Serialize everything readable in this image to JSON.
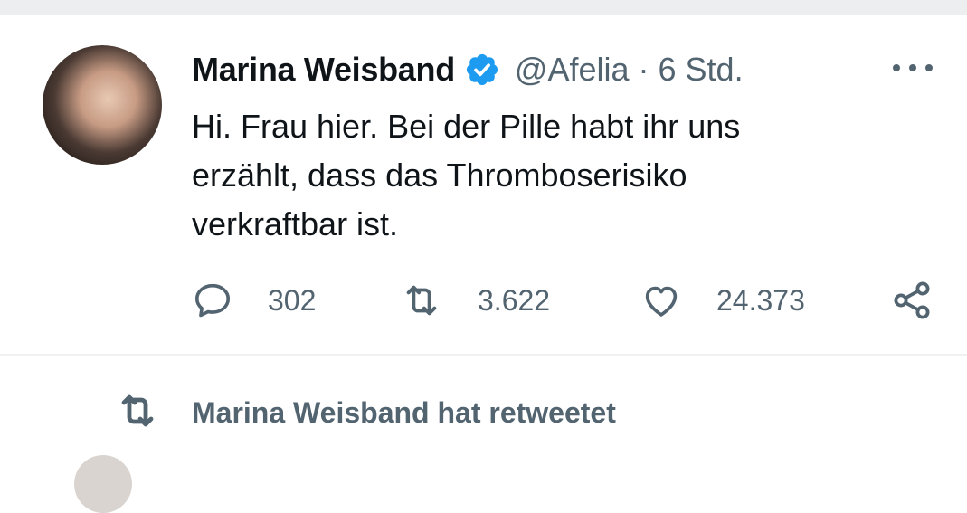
{
  "tweet": {
    "author_name": "Marina Weisband",
    "handle": "@Afelia",
    "separator": "·",
    "time": "6 Std.",
    "verified": true,
    "text": "Hi. Frau hier. Bei der Pille habt ihr uns\nerzählt, dass das Thromboserisiko\nverkraftbar ist.",
    "actions": {
      "replies": "302",
      "retweets": "3.622",
      "likes": "24.373"
    }
  },
  "retweet_context": {
    "label": "Marina Weisband hat retweetet"
  },
  "icons": {
    "verified": "verified-badge-icon",
    "more": "more-options-icon",
    "reply": "reply-icon",
    "retweet": "retweet-icon",
    "like": "heart-icon",
    "share": "share-icon"
  },
  "colors": {
    "text_primary": "#0f1419",
    "text_secondary": "#536471",
    "verified_blue": "#1d9bf0",
    "divider": "#eff1f3"
  }
}
